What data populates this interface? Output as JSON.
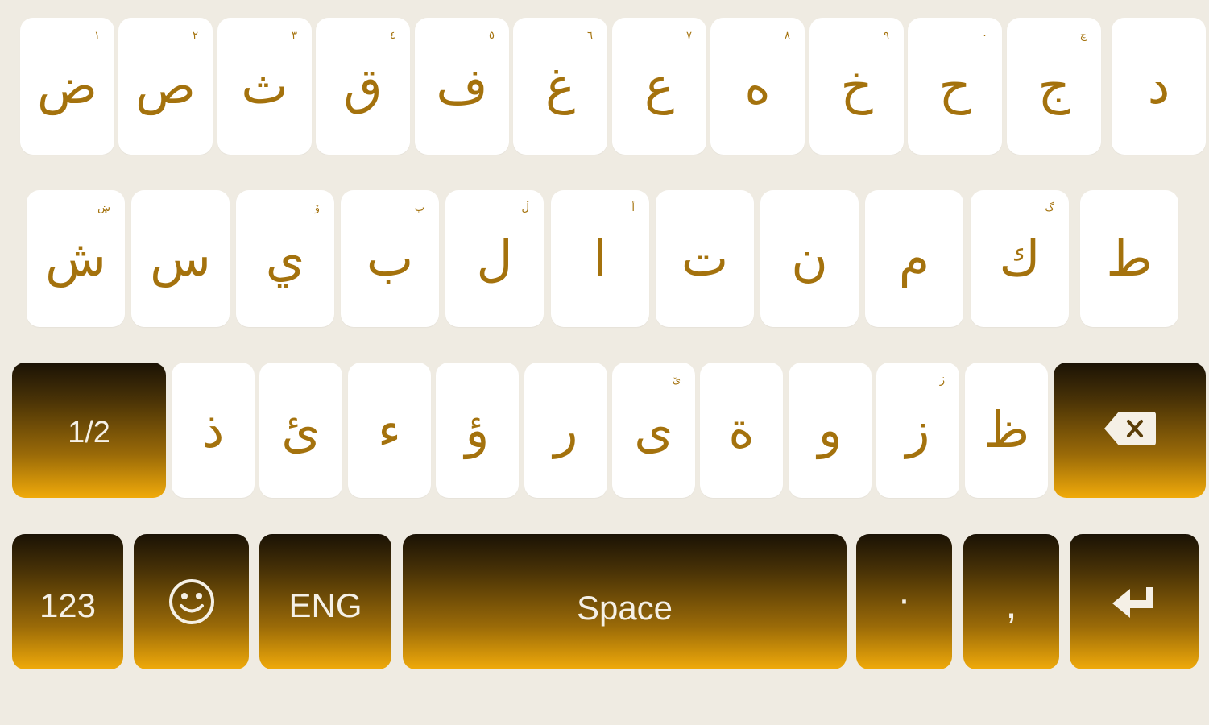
{
  "keyboard": {
    "row1": [
      {
        "main": "ض",
        "hint": "١"
      },
      {
        "main": "ص",
        "hint": "٢"
      },
      {
        "main": "ث",
        "hint": "٣"
      },
      {
        "main": "ق",
        "hint": "٤"
      },
      {
        "main": "ف",
        "hint": "٥"
      },
      {
        "main": "غ",
        "hint": "٦"
      },
      {
        "main": "ع",
        "hint": "٧"
      },
      {
        "main": "ه",
        "hint": "٨"
      },
      {
        "main": "خ",
        "hint": "٩"
      },
      {
        "main": "ح",
        "hint": "٠"
      },
      {
        "main": "ج",
        "hint": "چ"
      },
      {
        "main": "د",
        "hint": ""
      }
    ],
    "row2": [
      {
        "main": "ش",
        "hint": "ڜ"
      },
      {
        "main": "س",
        "hint": ""
      },
      {
        "main": "ي",
        "hint": "ۆ"
      },
      {
        "main": "ب",
        "hint": "پ"
      },
      {
        "main": "ل",
        "hint": "ڵ"
      },
      {
        "main": "ا",
        "hint": "أ"
      },
      {
        "main": "ت",
        "hint": ""
      },
      {
        "main": "ن",
        "hint": ""
      },
      {
        "main": "م",
        "hint": ""
      },
      {
        "main": "ك",
        "hint": "گ"
      },
      {
        "main": "ط",
        "hint": ""
      }
    ],
    "row3": [
      {
        "main": "ذ",
        "hint": ""
      },
      {
        "main": "ئ",
        "hint": ""
      },
      {
        "main": "ء",
        "hint": ""
      },
      {
        "main": "ؤ",
        "hint": ""
      },
      {
        "main": "ر",
        "hint": ""
      },
      {
        "main": "ى",
        "hint": "ێ"
      },
      {
        "main": "ة",
        "hint": ""
      },
      {
        "main": "و",
        "hint": ""
      },
      {
        "main": "ز",
        "hint": "ژ"
      },
      {
        "main": "ظ",
        "hint": ""
      }
    ],
    "shift_label": "1/2",
    "numbers_label": "123",
    "language_label": "ENG",
    "space_label": "Space",
    "period_label": "·",
    "comma_label": ",",
    "icons": {
      "backspace": "backspace-icon",
      "emoji": "smiley-icon",
      "enter": "enter-icon"
    },
    "colors": {
      "background": "#efebe2",
      "key": "#ffffff",
      "letter": "#a4720d",
      "func_top": "#1a1205",
      "func_bottom": "#f0aa0a",
      "func_text": "#f5f0e6"
    }
  }
}
